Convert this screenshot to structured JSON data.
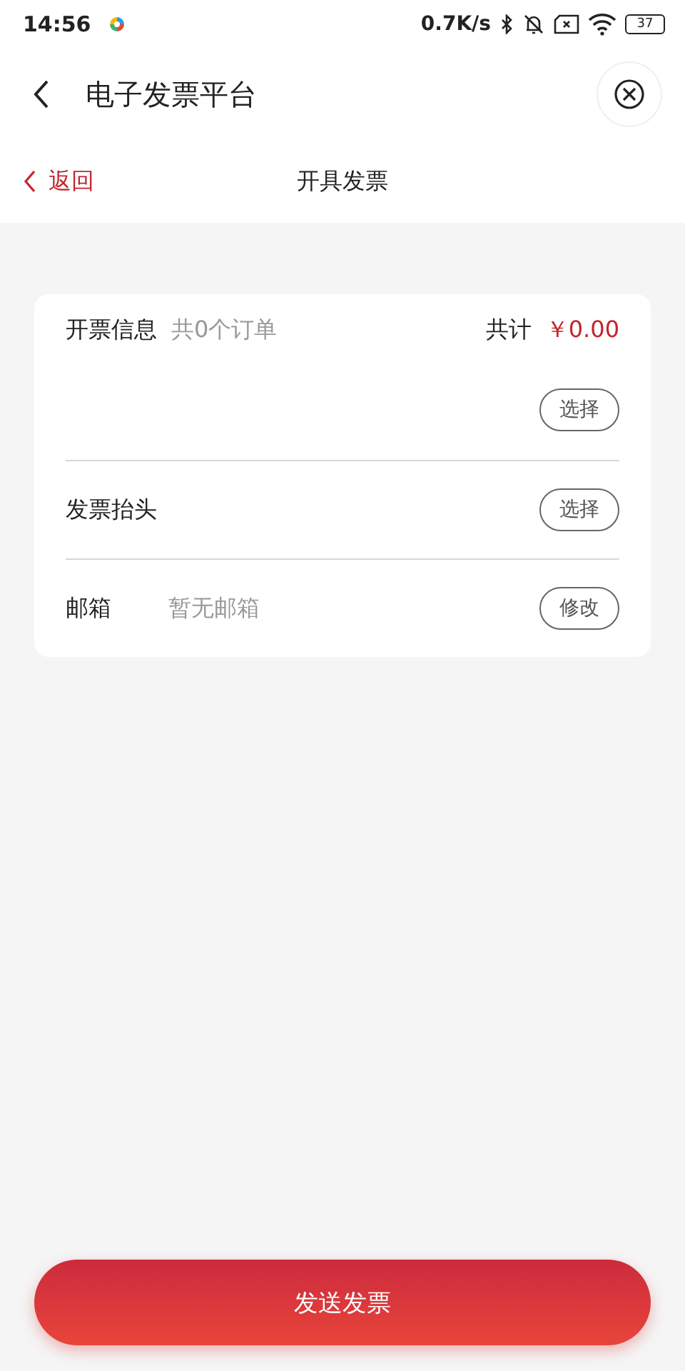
{
  "status_bar": {
    "time": "14:56",
    "net_speed": "0.7K/s",
    "battery": "37"
  },
  "nav": {
    "title": "电子发票平台"
  },
  "subheader": {
    "back_label": "返回",
    "title": "开具发票"
  },
  "card": {
    "info_label": "开票信息",
    "order_count": "共0个订单",
    "total_label": "共计",
    "total_amount": "￥0.00",
    "order_button": "选择",
    "rows": [
      {
        "label": "发票抬头",
        "button": "选择"
      },
      {
        "label": "邮箱",
        "value": "暂无邮箱",
        "button": "修改"
      }
    ]
  },
  "submit_button": "发送发票"
}
